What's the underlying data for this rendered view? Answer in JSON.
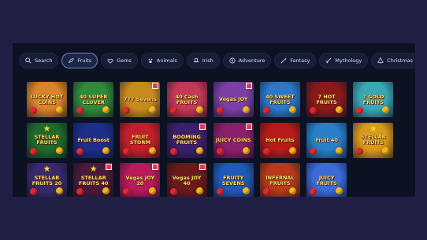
{
  "filters": [
    {
      "label": "Search",
      "icon": "search-icon",
      "active": false
    },
    {
      "label": "Fruits",
      "icon": "fruit-icon",
      "active": true
    },
    {
      "label": "Gems",
      "icon": "gem-icon",
      "active": false
    },
    {
      "label": "Animals",
      "icon": "paw-icon",
      "active": false
    },
    {
      "label": "Irish",
      "icon": "hat-icon",
      "active": false
    },
    {
      "label": "Adventure",
      "icon": "compass-icon",
      "active": false
    },
    {
      "label": "Fantasy",
      "icon": "wand-icon",
      "active": false
    },
    {
      "label": "Mythology",
      "icon": "sword-icon",
      "active": false
    },
    {
      "label": "Christmas",
      "icon": "tree-icon",
      "active": false
    }
  ],
  "games": [
    {
      "title": "LUCKY HOT COINS",
      "bg": "#d9832a",
      "gift": false
    },
    {
      "title": "40 SUPER CLOVER",
      "bg": "#2f8a3a",
      "gift": false
    },
    {
      "title": "777 Sevens",
      "bg": "#c98a1d",
      "gift": true
    },
    {
      "title": "40 Cash FRUITS",
      "bg": "#c23a56",
      "gift": false
    },
    {
      "title": "Vegas JOY",
      "bg": "#7b3fa5",
      "gift": true
    },
    {
      "title": "40 SWEET FRUITS",
      "bg": "#2b77c9",
      "gift": false
    },
    {
      "title": "7 HOT FRUITS",
      "bg": "#8a1a1a",
      "gift": false
    },
    {
      "title": "7 GOLD FRUITS",
      "bg": "#3aa7b5",
      "gift": false
    },
    {
      "title": "STELLAR FRUITS",
      "bg": "#1f6a2a",
      "gift": false
    },
    {
      "title": "Fruit Boost",
      "bg": "#1c2f8a",
      "gift": false
    },
    {
      "title": "FRUIT STORM",
      "bg": "#c21f2a",
      "gift": false
    },
    {
      "title": "BOOMING FRUITS",
      "bg": "#3a1f6b",
      "gift": true
    },
    {
      "title": "JUICY COINS",
      "bg": "#8a1f6b",
      "gift": true
    },
    {
      "title": "Hot Fruits",
      "bg": "#b81a1a",
      "gift": false
    },
    {
      "title": "Fruit 40",
      "bg": "#2780c9",
      "gift": false
    },
    {
      "title": "STELLAR FRUITS",
      "bg": "#d99a1a",
      "gift": false
    },
    {
      "title": "STELLAR FRUITS 20",
      "bg": "#3a2a6b",
      "gift": false
    },
    {
      "title": "STELLAR FRUITS 40",
      "bg": "#4a1a3a",
      "gift": true
    },
    {
      "title": "Vegas JOY 20",
      "bg": "#b81a5a",
      "gift": true
    },
    {
      "title": "Vegas JOY 40",
      "bg": "#6b1a1a",
      "gift": true
    },
    {
      "title": "FRUITY SEVENS",
      "bg": "#1f5ab8",
      "gift": false
    },
    {
      "title": "INFERNAL FRUITS",
      "bg": "#b83a1a",
      "gift": false
    },
    {
      "title": "JUICY FRUITS",
      "bg": "#3a6bd9",
      "gift": false
    }
  ]
}
